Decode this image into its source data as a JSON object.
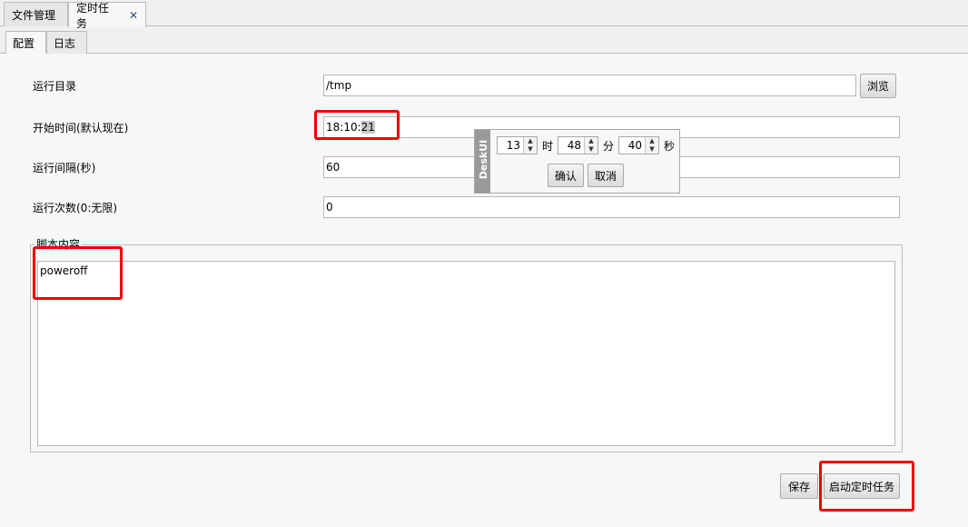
{
  "tabs": [
    {
      "label": "文件管理"
    },
    {
      "label": "定时任务",
      "close": "✕"
    }
  ],
  "subtabs": [
    {
      "label": "配置"
    },
    {
      "label": "日志"
    }
  ],
  "form": {
    "run_dir_label": "运行目录",
    "run_dir_value": "/tmp",
    "browse_label": "浏览",
    "start_time_label": "开始时间(默认现在)",
    "start_time_prefix": "18:10:",
    "start_time_selected": "21",
    "interval_label": "运行间隔(秒)",
    "interval_value": "60",
    "count_label": "运行次数(0:无限)",
    "count_value": "0",
    "script_group_label": "脚本内容",
    "script_value": "poweroff"
  },
  "buttons": {
    "save": "保存",
    "start_task": "启动定时任务"
  },
  "time_popup": {
    "side_label": "DeskUI",
    "hour": "13",
    "hour_unit": "时",
    "minute": "48",
    "minute_unit": "分",
    "second": "40",
    "second_unit": "秒",
    "confirm": "确认",
    "cancel": "取消"
  },
  "colors": {
    "highlight": "#f20000",
    "close_icon": "#2a4f8f"
  }
}
